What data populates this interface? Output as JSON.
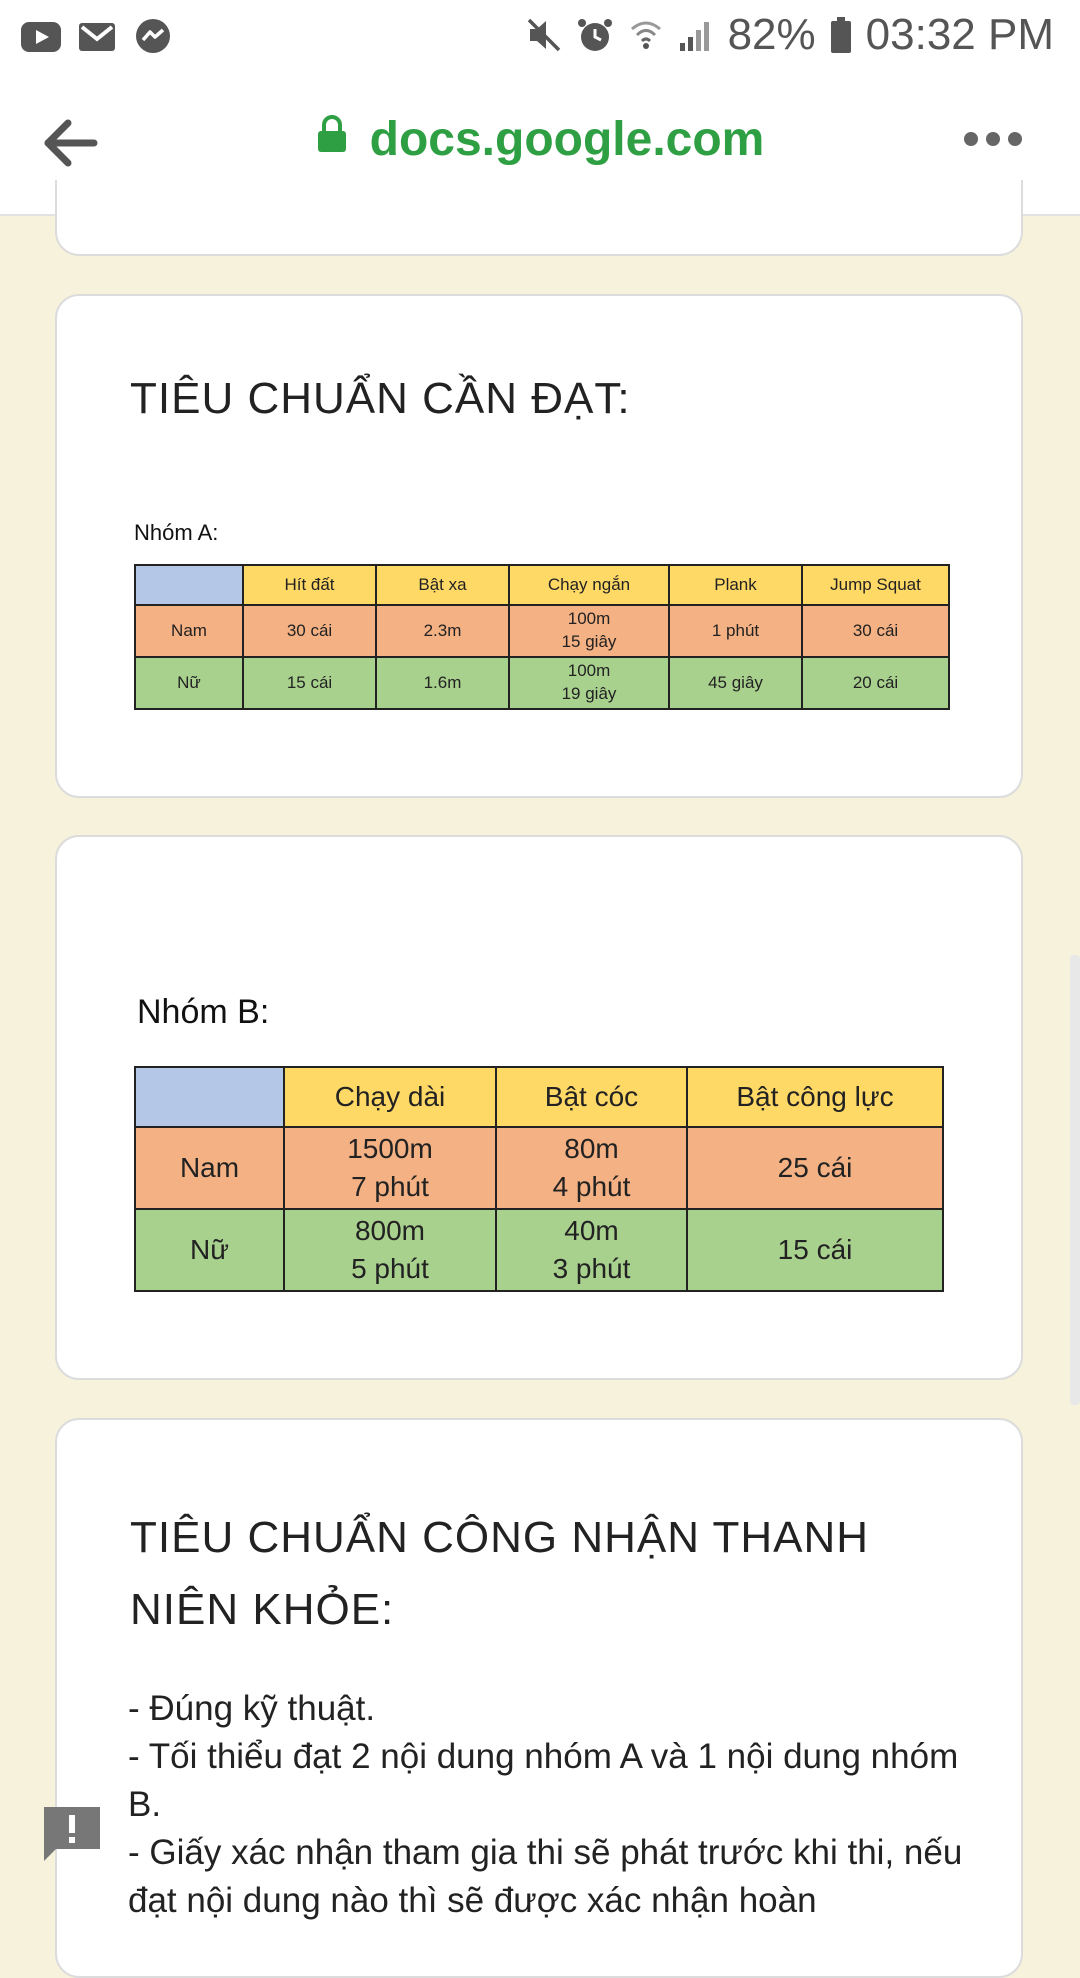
{
  "status_bar": {
    "battery": "82%",
    "time": "03:32 PM"
  },
  "browser": {
    "url": "docs.google.com"
  },
  "card1": {
    "title": "TIÊU CHUẨN CẦN ĐẠT:",
    "group_label": "Nhóm A:",
    "table": {
      "headers": [
        "",
        "Hít đất",
        "Bật xa",
        "Chạy ngắn",
        "Plank",
        "Jump Squat"
      ],
      "rows": [
        {
          "label": "Nam",
          "cells": [
            "30 cái",
            "2.3m",
            "100m\n15 giây",
            "1 phút",
            "30 cái"
          ]
        },
        {
          "label": "Nữ",
          "cells": [
            "15 cái",
            "1.6m",
            "100m\n19 giây",
            "45 giây",
            "20 cái"
          ]
        }
      ]
    }
  },
  "card2": {
    "group_label": "Nhóm B:",
    "table": {
      "headers": [
        "",
        "Chạy dài",
        "Bật cóc",
        "Bật công lực"
      ],
      "rows": [
        {
          "label": "Nam",
          "cells": [
            "1500m\n7 phút",
            "80m\n4 phút",
            "25 cái"
          ]
        },
        {
          "label": "Nữ",
          "cells": [
            "800m\n5 phút",
            "40m\n3 phút",
            "15 cái"
          ]
        }
      ]
    }
  },
  "card3": {
    "title_line1": "TIÊU CHUẨN CÔNG NHẬN THANH",
    "title_line2": "NIÊN KHỎE:",
    "lines": [
      "- Đúng kỹ thuật.",
      "- Tối thiểu đạt 2 nội dung nhóm A và 1 nội dung nhóm B.",
      "- Giấy xác nhận tham gia thi sẽ phát trước khi thi, nếu đạt nội dung nào thì sẽ được xác nhận hoàn"
    ]
  }
}
